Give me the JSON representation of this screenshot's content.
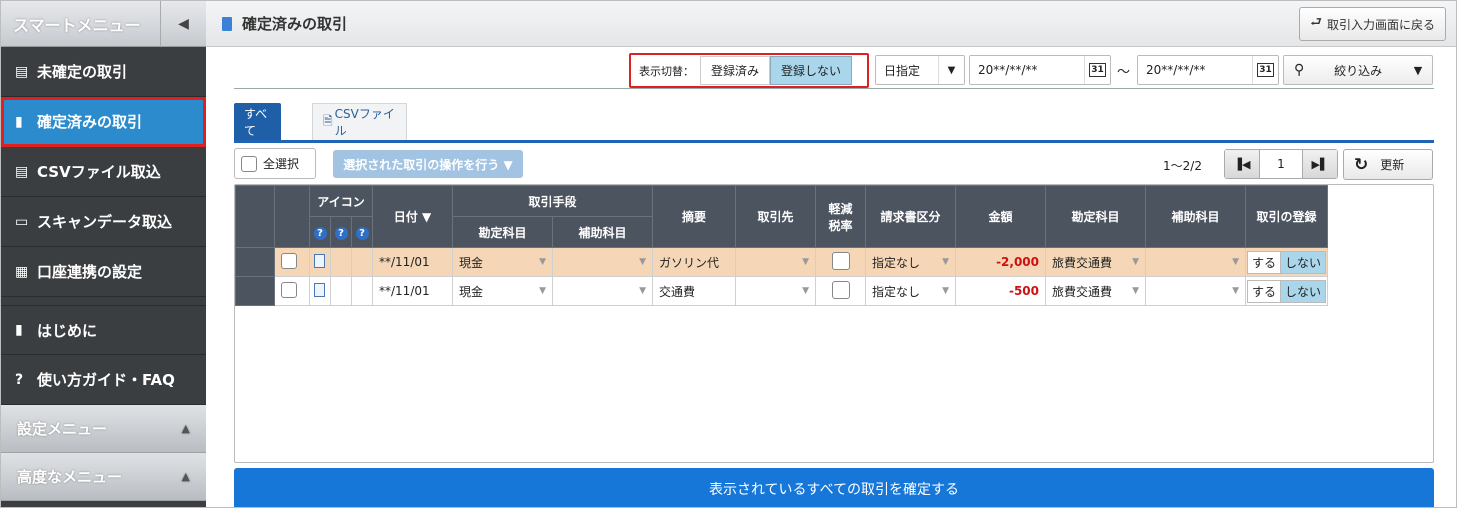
{
  "sidebar": {
    "title": "スマートメニュー",
    "collapse_icon": "chevron-left",
    "items": [
      {
        "label": "未確定の取引",
        "icon": "ledger-icon"
      },
      {
        "label": "確定済みの取引",
        "icon": "document-icon"
      },
      {
        "label": "CSVファイル取込",
        "icon": "import-icon"
      },
      {
        "label": "スキャンデータ取込",
        "icon": "scanner-icon"
      },
      {
        "label": "口座連携の設定",
        "icon": "bank-settings-icon"
      },
      {
        "label": "はじめに",
        "icon": "book-icon"
      },
      {
        "label": "使い方ガイド・FAQ",
        "icon": "help-icon"
      }
    ],
    "submenus": [
      {
        "label": "設定メニュー"
      },
      {
        "label": "高度なメニュー"
      }
    ]
  },
  "header": {
    "title": "確定済みの取引",
    "back_label": "取引入力画面に戻る"
  },
  "filter": {
    "switch_label": "表示切替：",
    "registered_label": "登録済み",
    "unregistered_label": "登録しない",
    "date_mode": "日指定",
    "date_from": "20**/**/**",
    "date_to": "20**/**/**",
    "calendar_text": "31",
    "tilde": "～",
    "narrow_label": "絞り込み"
  },
  "tabs": {
    "all": "すべて",
    "csv": "CSVファイル"
  },
  "toolbar": {
    "select_all": "全選択",
    "ops_label": "選択された取引の操作を行う ▼",
    "range": "1～2/2",
    "page": "1",
    "refresh": "更新"
  },
  "table": {
    "headers": {
      "icon": "アイコン",
      "q": "?",
      "date": "日付 ▼",
      "method": "取引手段",
      "method_account": "勘定科目",
      "method_sub": "補助科目",
      "summary": "摘要",
      "partner": "取引先",
      "reduced_1": "軽減",
      "reduced_2": "税率",
      "invoice": "請求書区分",
      "amount": "金額",
      "account": "勘定科目",
      "sub_account": "補助科目",
      "register": "取引の登録"
    },
    "rows": [
      {
        "date": "**/11/01",
        "method_account": "現金",
        "summary": "ガソリン代",
        "invoice": "指定なし",
        "amount": "-2,000",
        "account": "旅費交通費",
        "yes": "する",
        "no": "しない"
      },
      {
        "date": "**/11/01",
        "method_account": "現金",
        "summary": "交通費",
        "invoice": "指定なし",
        "amount": "-500",
        "account": "旅費交通費",
        "yes": "する",
        "no": "しない"
      }
    ]
  },
  "confirm_label": "表示されているすべての取引を確定する",
  "colors": {
    "accent": "#1677d9",
    "active_nav": "#2c8bcd",
    "highlight_border": "#e02020",
    "negative": "#d01010"
  }
}
